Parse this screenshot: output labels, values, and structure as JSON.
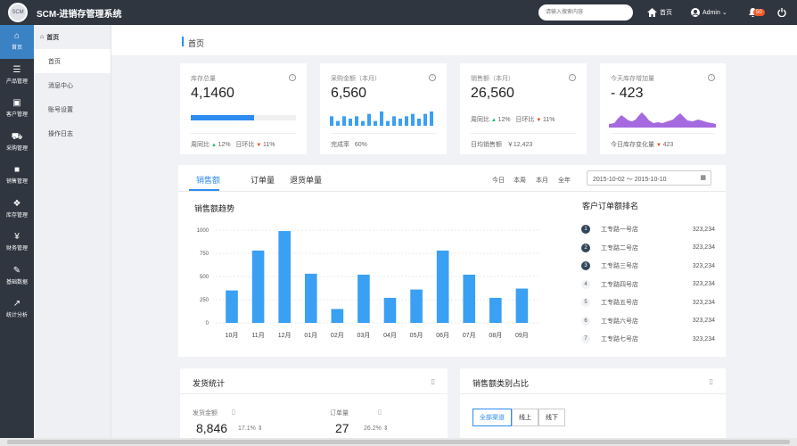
{
  "app": {
    "title": "SCM-进销存管理系统",
    "logo_text": "SCM"
  },
  "header": {
    "search_placeholder": "请输入搜索内容",
    "home_label": "首页",
    "user_label": "Admin",
    "notify_count": "50"
  },
  "sidebar": {
    "items": [
      {
        "label": "首页",
        "icon": "home-icon"
      },
      {
        "label": "产品管理",
        "icon": "list-icon"
      },
      {
        "label": "客户管理",
        "icon": "briefcase-icon"
      },
      {
        "label": "采购管理",
        "icon": "cart-icon"
      },
      {
        "label": "销售管理",
        "icon": "truck-icon"
      },
      {
        "label": "库存管理",
        "icon": "boxes-icon"
      },
      {
        "label": "财务管理",
        "icon": "yen-icon"
      },
      {
        "label": "基础数据",
        "icon": "edit-icon"
      },
      {
        "label": "统计分析",
        "icon": "line-chart-icon"
      }
    ]
  },
  "submenu": {
    "head": "首页",
    "items": [
      "首页",
      "消息中心",
      "账号设置",
      "操作日志"
    ]
  },
  "page": {
    "title": "首页"
  },
  "kpis": [
    {
      "label": "库存总量",
      "value": "4,1460",
      "progress": 0.6,
      "foot": {
        "wow_label": "周同比",
        "wow": "12%",
        "dod_label": "日环比",
        "dod": "11%"
      }
    },
    {
      "label": "采购金额（本月）",
      "value": "6,560",
      "bars": [
        4,
        2,
        4,
        3,
        4,
        2,
        5,
        2,
        6,
        2,
        4,
        3,
        4,
        5,
        3,
        5,
        6
      ],
      "foot": {
        "a_label": "完成率",
        "a": "60%"
      }
    },
    {
      "label": "销售额（本月）",
      "value": "26,560",
      "foot": {
        "wow_label": "周同比",
        "wow": "12%",
        "dod_label": "日环比",
        "dod": "11%",
        "daily_label": "日均销售额",
        "daily": "￥12,423"
      }
    },
    {
      "label": "今天库存增加量",
      "value": "- 423",
      "foot": {
        "a_label": "今日库存变化量",
        "a": "423"
      }
    }
  ],
  "colors": {
    "accent": "#2d8cf0",
    "bar": "#3aa0f3",
    "kpi_area": "#a66ae0",
    "up": "#19be6b",
    "down": "#ed4014"
  },
  "sales": {
    "tabs": [
      "销售额",
      "订单量",
      "退货单量"
    ],
    "ranges": [
      "今日",
      "本周",
      "本月",
      "全年"
    ],
    "date_range": "2015-10-02 ～ 2015-10-10",
    "chart_title": "销售额趋势",
    "ranking_title": "客户订单额排名",
    "ranking": [
      {
        "rank": "1",
        "name": "工专路一号店",
        "value": "323,234"
      },
      {
        "rank": "2",
        "name": "工专路二号店",
        "value": "323,234"
      },
      {
        "rank": "3",
        "name": "工专路三号店",
        "value": "323,234"
      },
      {
        "rank": "4",
        "name": "工专路四号店",
        "value": "323,234"
      },
      {
        "rank": "5",
        "name": "工专路五号店",
        "value": "323,234"
      },
      {
        "rank": "6",
        "name": "工专路六号店",
        "value": "323,234"
      },
      {
        "rank": "7",
        "name": "工专路七号店",
        "value": "323,234"
      }
    ]
  },
  "chart_data": {
    "type": "bar",
    "title": "销售额趋势",
    "categories": [
      "10月",
      "11月",
      "12月",
      "01月",
      "02月",
      "03月",
      "04月",
      "05月",
      "06月",
      "07月",
      "08月",
      "09月"
    ],
    "values": [
      350,
      780,
      990,
      530,
      150,
      520,
      270,
      360,
      780,
      520,
      270,
      370
    ],
    "ylim": [
      0,
      1000
    ],
    "yticks": [
      0,
      250,
      500,
      750,
      1000
    ],
    "grid": true
  },
  "delivery": {
    "title": "发货统计",
    "amount_label": "发货金额",
    "amount_value": "8,846",
    "amount_pct": "17.1%",
    "orders_label": "订单量",
    "orders_value": "27",
    "orders_pct": "26.2%"
  },
  "category": {
    "title": "销售额类别占比",
    "buttons": [
      "全部渠道",
      "线上",
      "线下"
    ]
  }
}
